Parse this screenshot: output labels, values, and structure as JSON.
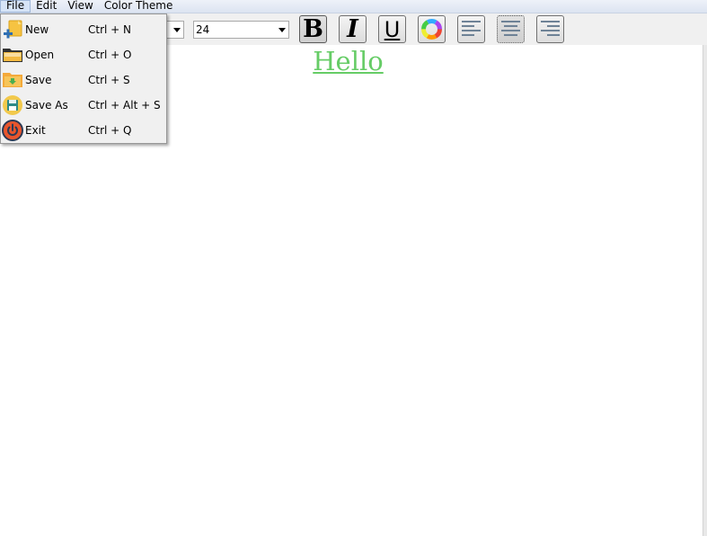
{
  "menubar": {
    "items": [
      {
        "label": "File"
      },
      {
        "label": "Edit"
      },
      {
        "label": "View"
      },
      {
        "label": "Color Theme"
      }
    ]
  },
  "toolbar": {
    "font_size_value": "24",
    "buttons": [
      "bold",
      "italic",
      "underline",
      "color-wheel",
      "align-left",
      "align-center",
      "align-right"
    ],
    "bold_label": "B",
    "italic_label": "I",
    "underline_label": "U"
  },
  "editor": {
    "text": "Hello",
    "text_color": "#66cc66"
  },
  "file_menu": {
    "items": [
      {
        "label": "New",
        "shortcut": "Ctrl + N",
        "icon": "new-file-icon"
      },
      {
        "label": "Open",
        "shortcut": "Ctrl + O",
        "icon": "open-folder-icon"
      },
      {
        "label": "Save",
        "shortcut": "Ctrl + S",
        "icon": "save-folder-icon"
      },
      {
        "label": "Save As",
        "shortcut": "Ctrl + Alt + S",
        "icon": "floppy-disk-icon"
      },
      {
        "label": "Exit",
        "shortcut": "Ctrl + Q",
        "icon": "power-icon"
      }
    ]
  }
}
